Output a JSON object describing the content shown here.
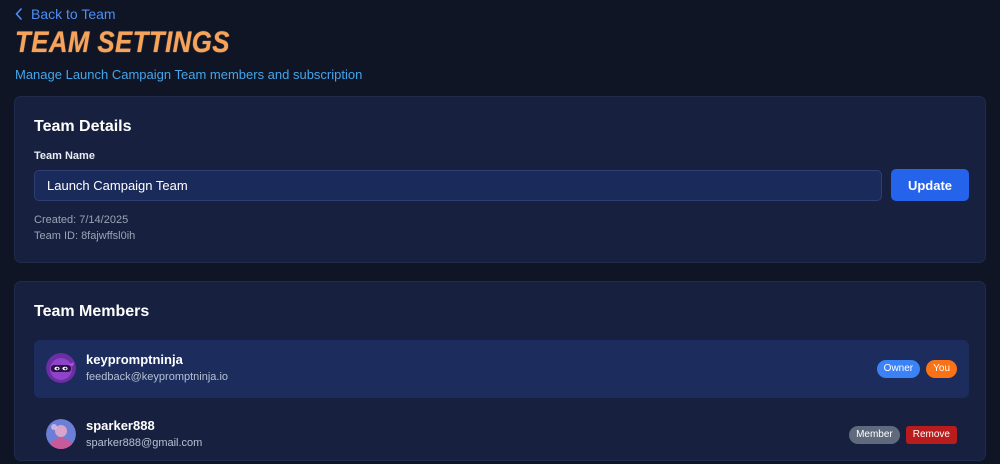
{
  "nav": {
    "back_label": "Back to Team"
  },
  "header": {
    "title": "TEAM SETTINGS",
    "subtitle": "Manage Launch Campaign Team members and subscription"
  },
  "team_details": {
    "heading": "Team Details",
    "name_label": "Team Name",
    "name_value": "Launch Campaign Team",
    "update_label": "Update",
    "created": "Created: 7/14/2025",
    "team_id": "Team ID: 8fajwffsl0ih"
  },
  "team_members": {
    "heading": "Team Members",
    "members": [
      {
        "username": "keypromptninja",
        "email": "feedback@keypromptninja.io",
        "badges": [
          "Owner",
          "You"
        ],
        "avatar_icon": "ninja-avatar-icon"
      },
      {
        "username": "sparker888",
        "email": "sparker888@gmail.com",
        "badges": [
          "Member"
        ],
        "remove_label": "Remove",
        "avatar_icon": "user-avatar-icon"
      }
    ]
  },
  "colors": {
    "background": "#0f1525",
    "card": "#17213f",
    "accent_title": "#f6a35c",
    "link": "#4d8ef5",
    "primary_button": "#2563eb",
    "owner_badge": "#3b82f6",
    "you_badge": "#f97316",
    "member_badge": "#5f6a7c",
    "remove_badge": "#b91c1c"
  }
}
